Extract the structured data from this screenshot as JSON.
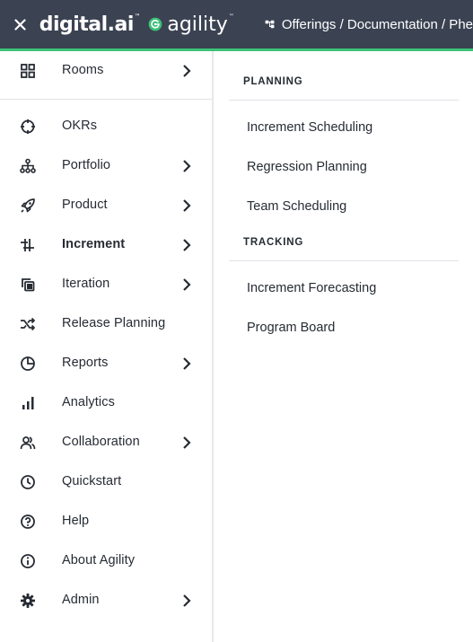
{
  "header": {
    "close_icon": "close-icon",
    "logo_digital": "digital.ai",
    "logo_agility": "agility",
    "breadcrumb": "Offerings / Documentation / Phe",
    "background_color": "#3b4252",
    "accent_color": "#3cc279"
  },
  "sidebar": {
    "items": [
      {
        "label": "Rooms",
        "icon": "grid-icon",
        "has_submenu": true
      },
      {
        "label": "OKRs",
        "icon": "crosshair-icon",
        "has_submenu": false
      },
      {
        "label": "Portfolio",
        "icon": "hierarchy-icon",
        "has_submenu": true
      },
      {
        "label": "Product",
        "icon": "rocket-icon",
        "has_submenu": true
      },
      {
        "label": "Increment",
        "icon": "increment-icon",
        "has_submenu": true,
        "active": true
      },
      {
        "label": "Iteration",
        "icon": "copy-icon",
        "has_submenu": true
      },
      {
        "label": "Release Planning",
        "icon": "shuffle-icon",
        "has_submenu": false
      },
      {
        "label": "Reports",
        "icon": "pie-chart-icon",
        "has_submenu": true
      },
      {
        "label": "Analytics",
        "icon": "bar-chart-icon",
        "has_submenu": false
      },
      {
        "label": "Collaboration",
        "icon": "users-icon",
        "has_submenu": true
      },
      {
        "label": "Quickstart",
        "icon": "clock-icon",
        "has_submenu": false
      },
      {
        "label": "Help",
        "icon": "help-icon",
        "has_submenu": false
      },
      {
        "label": "About Agility",
        "icon": "info-icon",
        "has_submenu": false
      },
      {
        "label": "Admin",
        "icon": "gear-icon",
        "has_submenu": true
      }
    ]
  },
  "submenu": {
    "planning": {
      "title": "PLANNING",
      "links": [
        "Increment Scheduling",
        "Regression Planning",
        "Team Scheduling"
      ]
    },
    "tracking": {
      "title": "TRACKING",
      "links": [
        "Increment Forecasting",
        "Program Board"
      ]
    }
  }
}
